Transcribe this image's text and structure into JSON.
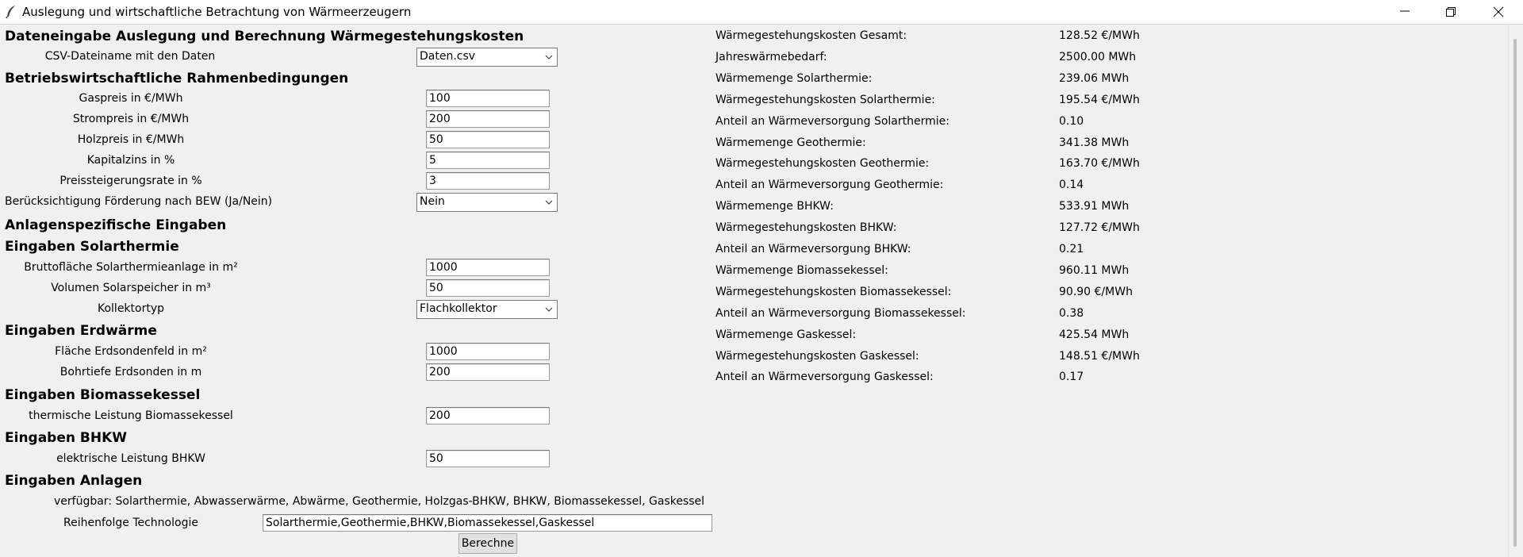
{
  "window": {
    "title": "Auslegung und wirtschaftliche Betrachtung von Wärmeerzeugern"
  },
  "form": {
    "section_data": "Dateneingabe Auslegung und Berechnung Wärmegestehungskosten",
    "csv_label": "CSV-Dateiname mit den Daten",
    "csv_value": "Daten.csv",
    "section_economic": "Betriebswirtschaftliche Rahmenbedingungen",
    "gas_label": "Gaspreis in €/MWh",
    "gas_value": "100",
    "strom_label": "Strompreis in €/MWh",
    "strom_value": "200",
    "holz_label": "Holzpreis in €/MWh",
    "holz_value": "50",
    "zins_label": "Kapitalzins in %",
    "zins_value": "5",
    "steig_label": "Preissteigerungsrate in %",
    "steig_value": "3",
    "bew_label": "Berücksichtigung Förderung nach BEW (Ja/Nein)",
    "bew_value": "Nein",
    "section_plant": "Anlagenspezifische Eingaben",
    "section_solar": "Eingaben Solarthermie",
    "solar_area_label": "Bruttofläche Solarthermieanlage in m²",
    "solar_area_value": "1000",
    "solar_vol_label": "Volumen Solarspeicher in m³",
    "solar_vol_value": "50",
    "collector_label": "Kollektortyp",
    "collector_value": "Flachkollektor",
    "section_geo": "Eingaben Erdwärme",
    "geo_area_label": "Fläche Erdsondenfeld in m²",
    "geo_area_value": "1000",
    "geo_depth_label": "Bohrtiefe Erdsonden in m",
    "geo_depth_value": "200",
    "section_bio": "Eingaben Biomassekessel",
    "bio_label": "thermische Leistung Biomassekessel",
    "bio_value": "200",
    "section_bhkw": "Eingaben BHKW",
    "bhkw_label": "elektrische Leistung BHKW",
    "bhkw_value": "50",
    "section_tech": "Eingaben Anlagen",
    "available_text": "verfügbar: Solarthermie, Abwasserwärme, Abwärme, Geothermie, Holzgas-BHKW, BHKW, Biomassekessel, Gaskessel",
    "order_label": "Reihenfolge Technologie",
    "order_value": "Solarthermie,Geothermie,BHKW,Biomassekessel,Gaskessel",
    "calc_button": "Berechne"
  },
  "results": [
    {
      "label": "Wärmegestehungskosten Gesamt:",
      "value": "128.52 €/MWh"
    },
    {
      "label": "Jahreswärmebedarf:",
      "value": "2500.00 MWh"
    },
    {
      "label": "Wärmemenge Solarthermie:",
      "value": "239.06 MWh"
    },
    {
      "label": "Wärmegestehungskosten Solarthermie:",
      "value": "195.54 €/MWh"
    },
    {
      "label": "Anteil an Wärmeversorgung Solarthermie:",
      "value": "0.10"
    },
    {
      "label": "Wärmemenge Geothermie:",
      "value": "341.38 MWh"
    },
    {
      "label": "Wärmegestehungskosten Geothermie:",
      "value": "163.70 €/MWh"
    },
    {
      "label": "Anteil an Wärmeversorgung Geothermie:",
      "value": "0.14"
    },
    {
      "label": "Wärmemenge BHKW:",
      "value": "533.91 MWh"
    },
    {
      "label": "Wärmegestehungskosten BHKW:",
      "value": "127.72 €/MWh"
    },
    {
      "label": "Anteil an Wärmeversorgung BHKW:",
      "value": "0.21"
    },
    {
      "label": "Wärmemenge Biomassekessel:",
      "value": "960.11 MWh"
    },
    {
      "label": "Wärmegestehungskosten Biomassekessel:",
      "value": "90.90 €/MWh"
    },
    {
      "label": "Anteil an Wärmeversorgung Biomassekessel:",
      "value": "0.38"
    },
    {
      "label": "Wärmemenge Gaskessel:",
      "value": "425.54 MWh"
    },
    {
      "label": "Wärmegestehungskosten Gaskessel:",
      "value": "148.51 €/MWh"
    },
    {
      "label": "Anteil an Wärmeversorgung Gaskessel:",
      "value": "0.17"
    }
  ]
}
